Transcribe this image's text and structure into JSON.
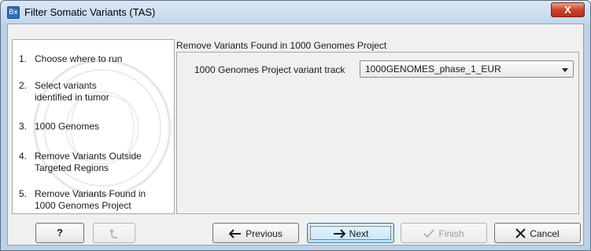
{
  "window": {
    "title": "Filter Somatic Variants (TAS)",
    "app_icon_text": "Bx",
    "close_glyph": "X"
  },
  "steps": [
    {
      "num": "1.",
      "label": "Choose where to run"
    },
    {
      "num": "2.",
      "label": "Select variants identified in tumor"
    },
    {
      "num": "3.",
      "label": "1000 Genomes"
    },
    {
      "num": "4.",
      "label": "Remove Variants Outside Targeted Regions"
    },
    {
      "num": "5.",
      "label": "Remove Variants Found in 1000 Genomes Project"
    }
  ],
  "content": {
    "title": "Remove Variants Found in 1000 Genomes Project",
    "field_label": "1000 Genomes Project variant track",
    "field_value": "1000GENOMES_phase_1_EUR"
  },
  "buttons": {
    "help": "?",
    "previous": "Previous",
    "next": "Next",
    "finish": "Finish",
    "cancel": "Cancel"
  },
  "colors": {
    "titlebar": "#c3d6ec",
    "close": "#c8442c",
    "default_button": "#c4e5f6",
    "arrow": "#1a1a1a"
  },
  "icons": {
    "help": "question-icon",
    "reset": "reset-icon",
    "previous": "arrow-left-icon",
    "next": "arrow-right-icon",
    "finish": "checkmark-icon",
    "cancel": "x-icon"
  }
}
